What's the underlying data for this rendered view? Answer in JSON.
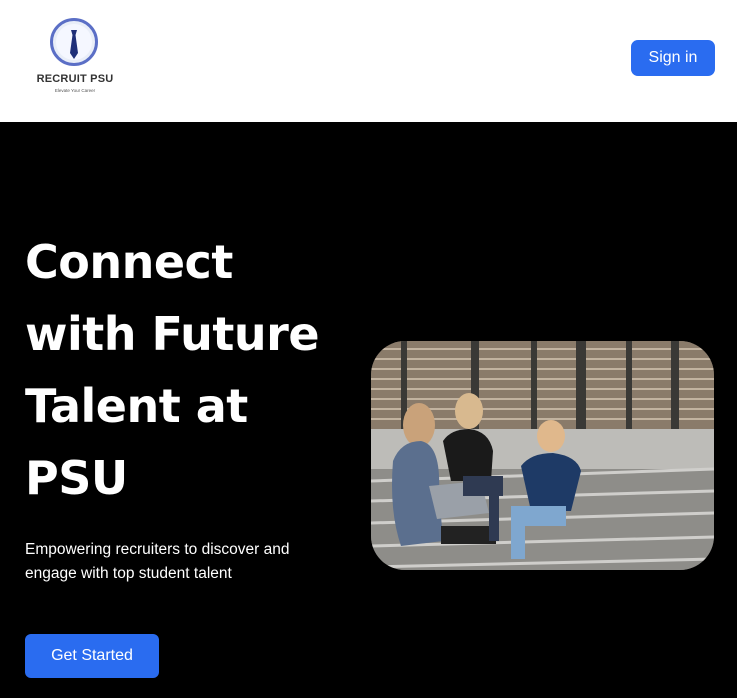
{
  "brand": {
    "name": "RECRUIT PSU",
    "tagline": "Elevate Your Career",
    "logo_icon": "tie-icon"
  },
  "header": {
    "signin_label": "Sign in"
  },
  "hero": {
    "title": "Connect with Future Talent at PSU",
    "subtitle": "Empowering recruiters to discover and engage with top student talent",
    "cta_label": "Get Started",
    "image_alt": "Three students sitting on outdoor steps talking, one holding a laptop"
  },
  "colors": {
    "accent": "#2a6cf0",
    "hero_bg": "#000000",
    "header_bg": "#ffffff"
  }
}
